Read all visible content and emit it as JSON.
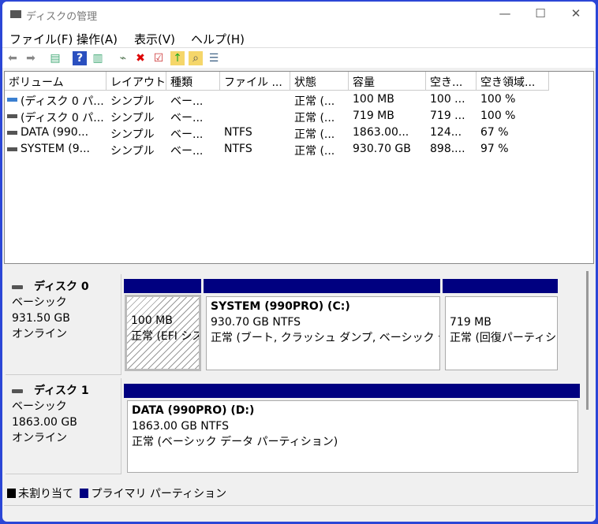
{
  "window": {
    "title": "ディスクの管理",
    "icon": "disk-management-icon"
  },
  "menu": [
    "ファイル(F)",
    "操作(A)",
    "表示(V)",
    "ヘルプ(H)"
  ],
  "toolbar": [
    "back-icon",
    "forward-icon",
    "console-tree-icon",
    "help-icon",
    "action-pane-icon",
    "connect-disk-icon",
    "delete-icon",
    "properties-icon",
    "open-folder-icon",
    "explore-icon",
    "settings-list-icon"
  ],
  "columns": [
    "ボリューム",
    "レイアウト",
    "種類",
    "ファイル ...",
    "状態",
    "容量",
    "空き...",
    "空き領域..."
  ],
  "rows": [
    [
      "(ディスク 0 パ...",
      "シンプル",
      "ベー...",
      "",
      "正常 (...",
      "100 MB",
      "100 ...",
      "100 %"
    ],
    [
      "(ディスク 0 パ...",
      "シンプル",
      "ベー...",
      "",
      "正常 (...",
      "719 MB",
      "719 ...",
      "100 %"
    ],
    [
      "DATA (990...",
      "シンプル",
      "ベー...",
      "NTFS",
      "正常 (...",
      "1863.00...",
      "124...",
      "67 %"
    ],
    [
      "SYSTEM (9...",
      "シンプル",
      "ベー...",
      "NTFS",
      "正常 (...",
      "930.70 GB",
      "898....",
      "97 %"
    ]
  ],
  "disks": [
    {
      "name": "ディスク 0",
      "type": "ベーシック",
      "size": "931.50 GB",
      "status": "オンライン",
      "partitions": [
        {
          "title": "",
          "size": "100 MB",
          "status": "正常 (EFI システム パーティション)"
        },
        {
          "title": "SYSTEM (990PRO)  (C:)",
          "size": "930.70 GB NTFS",
          "status": "正常 (ブート, クラッシュ ダンプ, ベーシック データ パーティション)"
        },
        {
          "title": "",
          "size": "719 MB",
          "status": "正常 (回復パーティション)"
        }
      ]
    },
    {
      "name": "ディスク 1",
      "type": "ベーシック",
      "size": "1863.00 GB",
      "status": "オンライン",
      "partitions": [
        {
          "title": "DATA (990PRO)  (D:)",
          "size": "1863.00 GB NTFS",
          "status": "正常 (ベーシック データ パーティション)"
        }
      ]
    }
  ],
  "legend": [
    {
      "label": "未割り当て",
      "color": "#000000"
    },
    {
      "label": "プライマリ パーティション",
      "color": "#000080"
    }
  ],
  "colors": {
    "primary": "#000080",
    "border": "#2b46d6"
  }
}
